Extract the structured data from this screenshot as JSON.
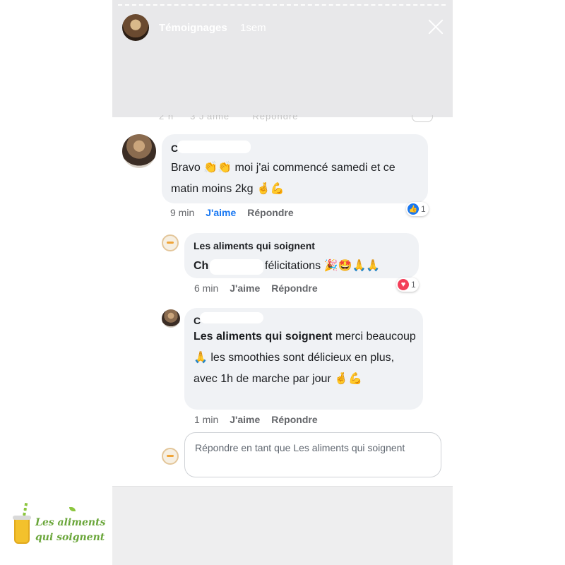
{
  "story": {
    "username": "Témoignages",
    "time": "1sem",
    "close_icon": "close-icon"
  },
  "comments": [
    {
      "author": "C",
      "text": "Bravo 👏👏 moi j'ai commencé samedi et ce matin moins 2kg 🤞💪",
      "time": "9 min",
      "like_label": "J'aime",
      "reply_label": "Répondre",
      "reaction_count": "1",
      "reaction_icon": "like-icon"
    },
    {
      "author": "Les aliments qui soignent",
      "text_prefix": "Ch",
      "text": "félicitations 🎉🤩🙏🙏",
      "time": "6 min",
      "like_label": "J'aime",
      "reply_label": "Répondre",
      "reaction_count": "1",
      "reaction_icon": "love-icon"
    },
    {
      "author": "C",
      "mention": "Les aliments qui soignent",
      "text": "merci beaucoup 🙏 les smoothies sont délicieux en plus, avec 1h de marche par jour 🤞💪",
      "time": "1 min",
      "like_label": "J'aime",
      "reply_label": "Répondre"
    }
  ],
  "reply_box": {
    "placeholder": "Répondre en tant que Les aliments qui soignent"
  },
  "logo": {
    "line1": "Les aliments",
    "line2": "qui soignent"
  },
  "colors": {
    "accent_blue": "#1877f2",
    "love_red": "#f33e58",
    "bubble_gray": "#f0f2f5",
    "logo_green": "#6aa63a"
  }
}
